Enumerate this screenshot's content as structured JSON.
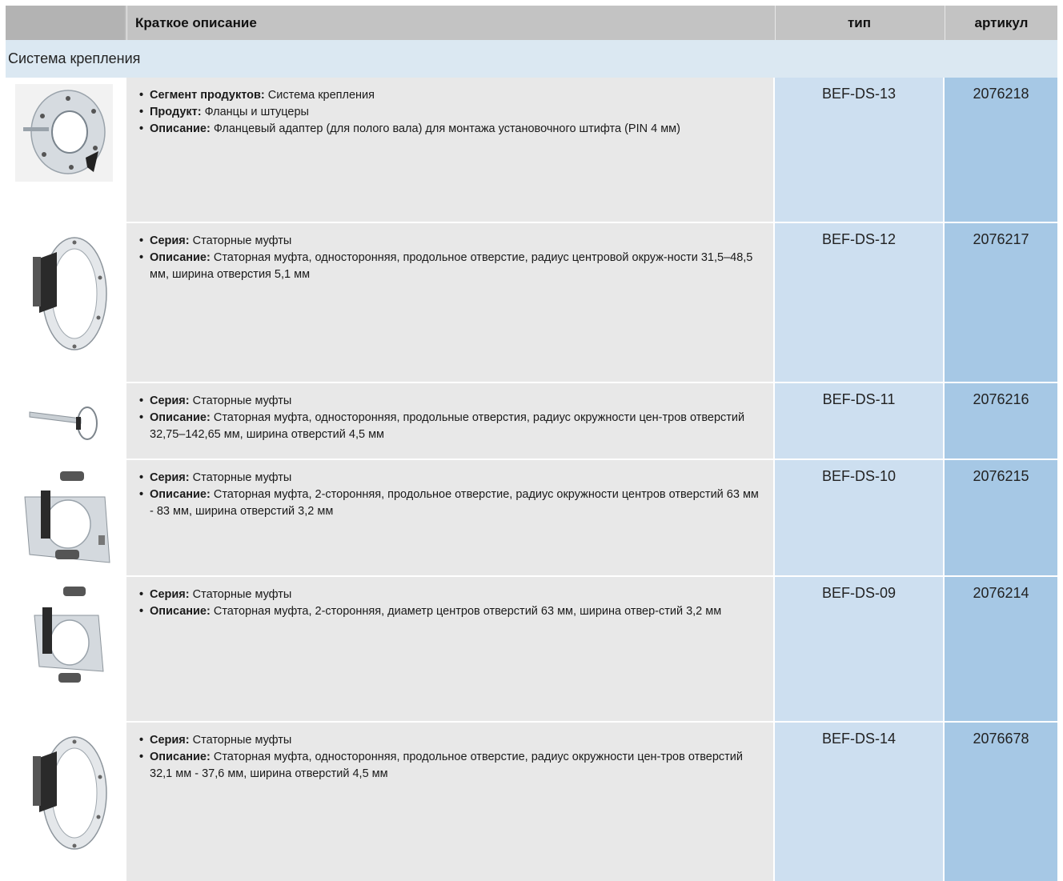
{
  "header": {
    "desc": "Краткое описание",
    "type": "тип",
    "article": "артикул"
  },
  "section": "Система крепления",
  "rows": [
    {
      "image": "flange-adapter",
      "items": [
        {
          "label": "Сегмент продуктов:",
          "text": " Система крепления"
        },
        {
          "label": "Продукт:",
          "text": " Фланцы и штуцеры"
        },
        {
          "label": "Описание:",
          "text": " Фланцевый адаптер (для полого вала) для монтажа установочного штифта (PIN 4 мм)"
        }
      ],
      "type": "BEF-DS-13",
      "article": "2076218"
    },
    {
      "image": "stator-coupling-one-sided",
      "items": [
        {
          "label": "Серия:",
          "text": " Статорные муфты"
        },
        {
          "label": "Описание:",
          "text": " Статорная муфта, односторонняя, продольное отверстие, радиус центровой окруж-ности 31,5–48,5 мм, ширина отверстия 5,1 мм"
        }
      ],
      "type": "BEF-DS-12",
      "article": "2076217"
    },
    {
      "image": "stator-coupling-long-arm",
      "items": [
        {
          "label": "Серия:",
          "text": " Статорные муфты"
        },
        {
          "label": "Описание:",
          "text": " Статорная муфта, односторонняя, продольные отверстия, радиус окружности цен-тров отверстий 32,75–142,65 мм, ширина отверстий 4,5 мм"
        }
      ],
      "type": "BEF-DS-11",
      "article": "2076216"
    },
    {
      "image": "stator-coupling-two-sided",
      "items": [
        {
          "label": "Серия:",
          "text": " Статорные муфты"
        },
        {
          "label": "Описание:",
          "text": " Статорная муфта, 2-сторонняя, продольное отверстие, радиус окружности центров отверстий 63 мм - 83 мм, ширина отверстий 3,2 мм"
        }
      ],
      "type": "BEF-DS-10",
      "article": "2076215"
    },
    {
      "image": "stator-coupling-two-sided",
      "items": [
        {
          "label": "Серия:",
          "text": " Статорные муфты"
        },
        {
          "label": "Описание:",
          "text": " Статорная муфта, 2-сторонняя, диаметр центров отверстий 63 мм, ширина отвер-стий 3,2 мм"
        }
      ],
      "type": "BEF-DS-09",
      "article": "2076214"
    },
    {
      "image": "stator-coupling-one-sided",
      "items": [
        {
          "label": "Серия:",
          "text": " Статорные муфты"
        },
        {
          "label": "Описание:",
          "text": " Статорная муфта, односторонняя, продольное отверстие, радиус окружности цен-тров отверстий 32,1 мм - 37,6 мм, ширина отверстий 4,5 мм"
        }
      ],
      "type": "BEF-DS-14",
      "article": "2076678"
    }
  ]
}
